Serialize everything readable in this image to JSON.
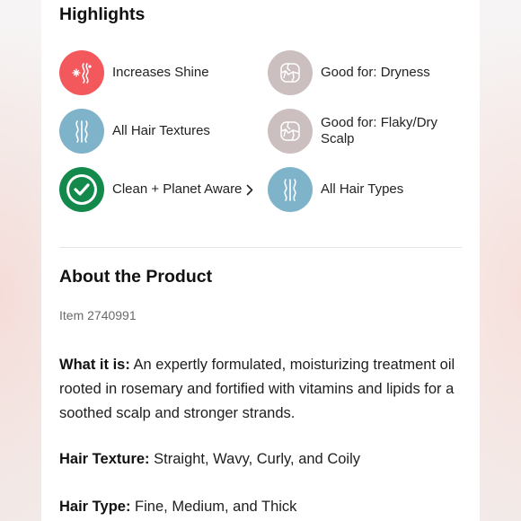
{
  "highlights": {
    "title": "Highlights",
    "items": [
      {
        "label": "Increases Shine",
        "icon": "sparkle-shine-icon",
        "color": "#f2585c"
      },
      {
        "label": "Good for: Dryness",
        "icon": "cracked-dryness-icon",
        "color": "#cbbfc0"
      },
      {
        "label": "All Hair Textures",
        "icon": "hair-strands-icon",
        "color": "#7fb3c9"
      },
      {
        "label": "Good for: Flaky/Dry Scalp",
        "icon": "cracked-scalp-icon",
        "color": "#cbbfc0"
      },
      {
        "label": "Clean + Planet Aware",
        "icon": "checkmark-badge-icon",
        "color": "#138a4c"
      },
      {
        "label": "All Hair Types",
        "icon": "hair-strands-icon",
        "color": "#7fb3c9"
      }
    ]
  },
  "about": {
    "title": "About the Product",
    "item_number": "Item 2740991",
    "what_it_is_label": "What it is:",
    "what_it_is_text": " An expertly formulated, moisturizing treatment oil rooted in rosemary and fortified with vitamins and lipids for a soothed scalp and stronger strands.",
    "hair_texture_label": "Hair Texture:",
    "hair_texture_text": " Straight, Wavy, Curly, and Coily",
    "hair_type_label": "Hair Type:",
    "hair_type_text": " Fine, Medium, and Thick"
  }
}
